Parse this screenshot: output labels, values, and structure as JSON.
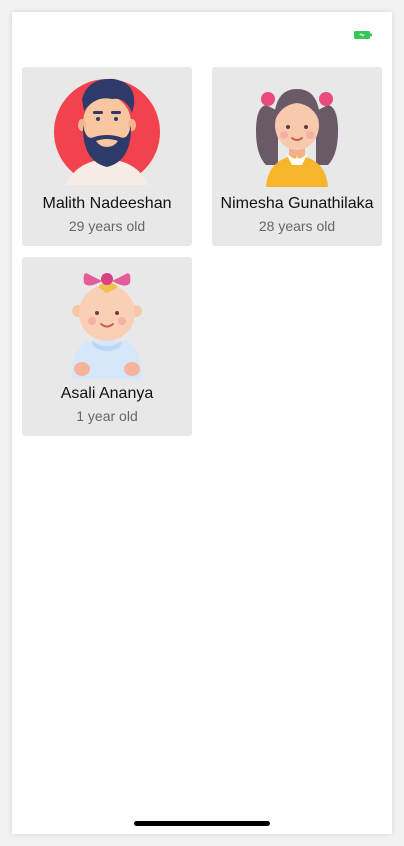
{
  "status_bar": {
    "battery_icon": "battery-charging-icon",
    "battery_color": "#34c759"
  },
  "people": [
    {
      "name": "Malith Nadeeshan",
      "age": "29 years old",
      "avatar_icon": "bearded-man-avatar-icon"
    },
    {
      "name": "Nimesha Gunathilaka",
      "age": "28 years old",
      "avatar_icon": "girl-avatar-icon"
    },
    {
      "name": "Asali Ananya",
      "age": "1 year old",
      "avatar_icon": "baby-avatar-icon"
    }
  ]
}
